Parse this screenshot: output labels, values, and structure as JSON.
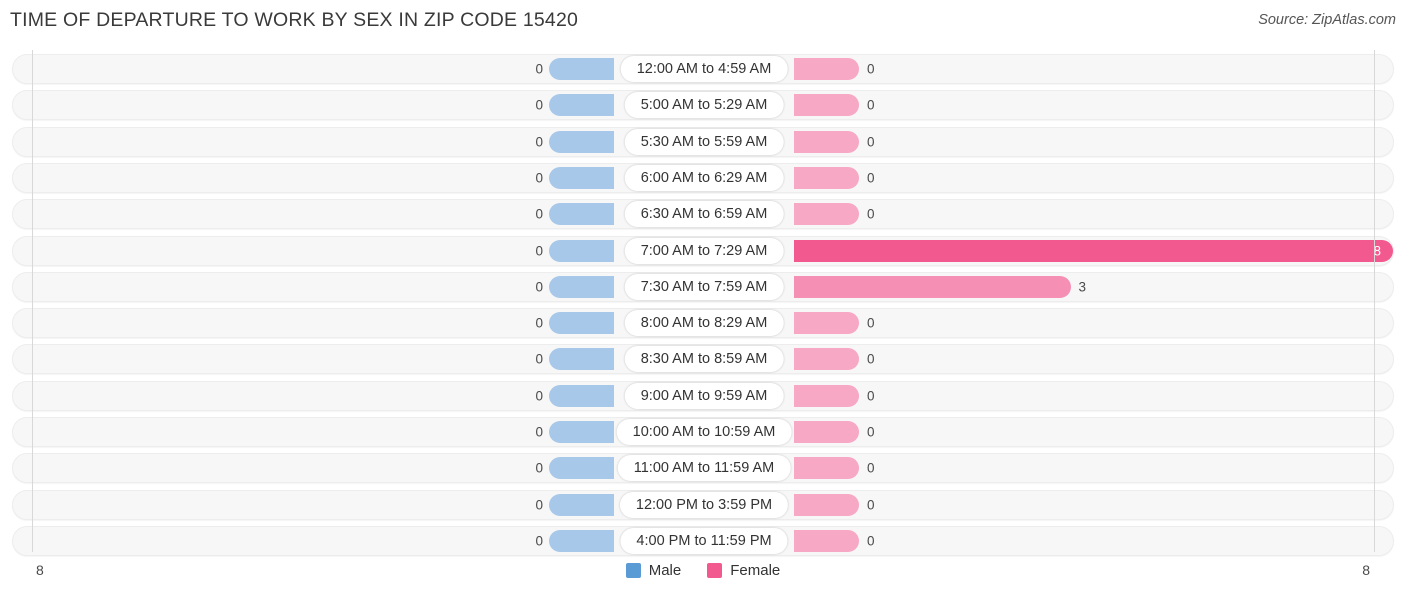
{
  "header": {
    "title": "TIME OF DEPARTURE TO WORK BY SEX IN ZIP CODE 15420",
    "source": "Source: ZipAtlas.com"
  },
  "legend": {
    "male_label": "Male",
    "female_label": "Female",
    "male_color": "#5b9bd5",
    "female_color": "#f2598e"
  },
  "axis": {
    "left_end": "8",
    "right_end": "8"
  },
  "chart_data": {
    "type": "bar",
    "title": "TIME OF DEPARTURE TO WORK BY SEX IN ZIP CODE 15420",
    "subtitle": "Source: ZipAtlas.com",
    "orientation": "horizontal-diverging",
    "xlabel": "",
    "ylabel": "",
    "xlim": [
      8,
      8
    ],
    "axis_left_max": 8,
    "axis_right_max": 8,
    "grid": false,
    "legend_position": "bottom-center",
    "categories": [
      "12:00 AM to 4:59 AM",
      "5:00 AM to 5:29 AM",
      "5:30 AM to 5:59 AM",
      "6:00 AM to 6:29 AM",
      "6:30 AM to 6:59 AM",
      "7:00 AM to 7:29 AM",
      "7:30 AM to 7:59 AM",
      "8:00 AM to 8:29 AM",
      "8:30 AM to 8:59 AM",
      "9:00 AM to 9:59 AM",
      "10:00 AM to 10:59 AM",
      "11:00 AM to 11:59 AM",
      "12:00 PM to 3:59 PM",
      "4:00 PM to 11:59 PM"
    ],
    "series": [
      {
        "name": "Male",
        "color": "#a8c8ea",
        "values": [
          0,
          0,
          0,
          0,
          0,
          0,
          0,
          0,
          0,
          0,
          0,
          0,
          0,
          0
        ]
      },
      {
        "name": "Female",
        "color": "#f7a8c4",
        "values": [
          0,
          0,
          0,
          0,
          0,
          8,
          3,
          0,
          0,
          0,
          0,
          0,
          0,
          0
        ]
      }
    ]
  },
  "rows": [
    {
      "label": "12:00 AM to 4:59 AM",
      "male": "0",
      "female": "0",
      "male_v": 0,
      "female_v": 0,
      "female_color": "#f7a8c4"
    },
    {
      "label": "5:00 AM to 5:29 AM",
      "male": "0",
      "female": "0",
      "male_v": 0,
      "female_v": 0,
      "female_color": "#f7a8c4"
    },
    {
      "label": "5:30 AM to 5:59 AM",
      "male": "0",
      "female": "0",
      "male_v": 0,
      "female_v": 0,
      "female_color": "#f7a8c4"
    },
    {
      "label": "6:00 AM to 6:29 AM",
      "male": "0",
      "female": "0",
      "male_v": 0,
      "female_v": 0,
      "female_color": "#f7a8c4"
    },
    {
      "label": "6:30 AM to 6:59 AM",
      "male": "0",
      "female": "0",
      "male_v": 0,
      "female_v": 0,
      "female_color": "#f7a8c4"
    },
    {
      "label": "7:00 AM to 7:29 AM",
      "male": "0",
      "female": "8",
      "male_v": 0,
      "female_v": 8,
      "female_color": "#f2598e",
      "female_inside": true
    },
    {
      "label": "7:30 AM to 7:59 AM",
      "male": "0",
      "female": "3",
      "male_v": 0,
      "female_v": 3,
      "female_color": "#f590b4"
    },
    {
      "label": "8:00 AM to 8:29 AM",
      "male": "0",
      "female": "0",
      "male_v": 0,
      "female_v": 0,
      "female_color": "#f7a8c4"
    },
    {
      "label": "8:30 AM to 8:59 AM",
      "male": "0",
      "female": "0",
      "male_v": 0,
      "female_v": 0,
      "female_color": "#f7a8c4"
    },
    {
      "label": "9:00 AM to 9:59 AM",
      "male": "0",
      "female": "0",
      "male_v": 0,
      "female_v": 0,
      "female_color": "#f7a8c4"
    },
    {
      "label": "10:00 AM to 10:59 AM",
      "male": "0",
      "female": "0",
      "male_v": 0,
      "female_v": 0,
      "female_color": "#f7a8c4"
    },
    {
      "label": "11:00 AM to 11:59 AM",
      "male": "0",
      "female": "0",
      "male_v": 0,
      "female_v": 0,
      "female_color": "#f7a8c4"
    },
    {
      "label": "12:00 PM to 3:59 PM",
      "male": "0",
      "female": "0",
      "male_v": 0,
      "female_v": 0,
      "female_color": "#f7a8c4"
    },
    {
      "label": "4:00 PM to 11:59 PM",
      "male": "0",
      "female": "0",
      "male_v": 0,
      "female_v": 0,
      "female_color": "#f7a8c4"
    }
  ]
}
